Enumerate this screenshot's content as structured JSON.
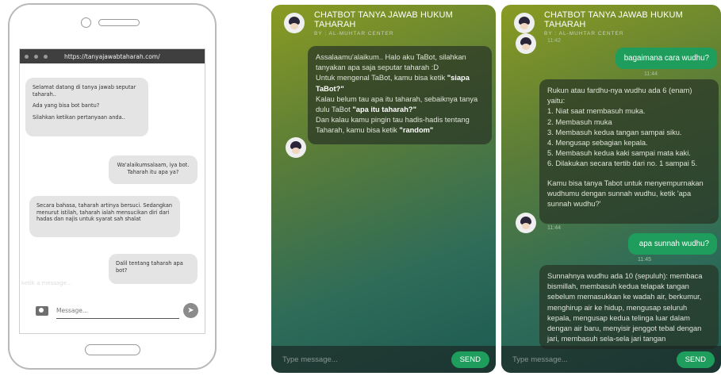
{
  "wireframe": {
    "url": "https://tanyajawabtaharah.com/",
    "messages": [
      {
        "lines": [
          "Selamat datang di tanya jawab seputar taharah..",
          "Ada yang bisa bot bantu?",
          "Silahkan ketikan pertanyaan anda.."
        ]
      },
      {
        "text": "Wa'alaikumsalaam, iya bot. Taharah itu apa ya?"
      },
      {
        "text": "Secara bahasa, taharah artinya bersuci. Sedangkan menurut istilah, taharah ialah mensucikan diri dari hadas dan najis untuk syarat sah shalat"
      },
      {
        "text": "Dalil tentang taharah apa bot?"
      }
    ],
    "ghost_text": "ketik a message...",
    "input_placeholder": "Message..."
  },
  "chat_left": {
    "title": "CHATBOT TANYA JAWAB HUKUM TAHARAH",
    "subtitle": "BY : AL-MUHTAR CENTER",
    "greeting": {
      "p1": "Assalaamu'alaikum.. Halo aku TaBot, silahkan tanyakan apa saja seputar taharah :D",
      "p2_pre": "Untuk mengenal TaBot, kamu bisa ketik ",
      "p2_bold": "\"siapa TaBot?\"",
      "p3_pre": "Kalau belum tau apa itu taharah, sebaiknya tanya dulu TaBot ",
      "p3_bold": "\"apa itu taharah?\"",
      "p4_pre": "Dan kalau kamu pingin tau hadis-hadis tentang Taharah, kamu bisa ketik ",
      "p4_bold": "\"random\""
    },
    "input_placeholder": "Type message...",
    "send_label": "SEND"
  },
  "chat_right": {
    "title": "CHATBOT TANYA JAWAB HUKUM TAHARAH",
    "subtitle": "BY : AL-MUHTAR CENTER",
    "time0": "11:42",
    "user1": "bagaimana cara wudhu?",
    "time1": "11:44",
    "bot2": {
      "intro": "Rukun atau fardhu-nya wudhu ada 6 (enam) yaitu:",
      "items": [
        "1. Niat saat membasuh muka.",
        "2. Membasuh muka",
        "3. Membasuh kedua tangan sampai siku.",
        "4. Mengusap sebagian kepala.",
        "5. Membasuh kedua kaki sampai mata kaki.",
        "6. Dilakukan secara tertib dari no. 1 sampai 5."
      ],
      "outro": "Kamu bisa tanya Tabot untuk menyempurnakan wudhumu dengan sunnah wudhu, ketik 'apa sunnah wudhu?'"
    },
    "time2": "11:44",
    "user2": "apa sunnah wudhu?",
    "time3": "11:45",
    "bot3": "Sunnahnya wudhu ada 10 (sepuluh): membaca bismillah, membasuh kedua telapak tangan sebelum memasukkan ke wadah air, berkumur, menghirup air ke hidup, mengusap seluruh kepala, mengusap kedua telinga luar dalam dengan air baru, menyisir jenggot tebal dengan jari, membasuh sela-sela jari tangan",
    "input_placeholder": "Type message...",
    "send_label": "SEND"
  },
  "colors": {
    "accent_green": "#1e9d5c",
    "panel_gradient_top": "#8a9b22",
    "panel_gradient_bottom": "#1d5a52"
  }
}
